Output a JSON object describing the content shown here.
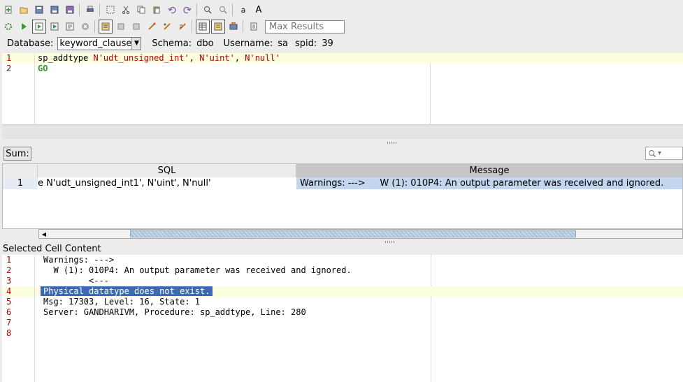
{
  "toolbar": {
    "row1_icons": [
      "new-file-icon",
      "open-file-icon",
      "save-icon",
      "save-as-icon",
      "save-all-icon",
      "print-icon",
      "select-icon",
      "cut-icon",
      "copy-icon",
      "paste-icon",
      "undo-icon",
      "redo-icon",
      "find-icon",
      "find-replace-icon",
      "font-smaller-icon",
      "font-larger-icon"
    ],
    "row2_icons": [
      "run-config-icon",
      "execute-icon",
      "execute-current-icon",
      "execute-all-icon",
      "execute-script-icon",
      "stop-icon",
      "auto-commit-icon",
      "commit-icon",
      "rollback-icon",
      "format-icon",
      "explain-icon",
      "query-builder-icon",
      "results-grid-icon",
      "results-text-icon",
      "export-icon",
      "history-icon"
    ],
    "font_smaller_label": "a",
    "font_larger_label": "A",
    "max_results_placeholder": "Max Results"
  },
  "dbbar": {
    "database_label": "Database:",
    "database_value": "keyword_clause",
    "schema_label": "Schema:",
    "schema_value": "dbo",
    "username_label": "Username:",
    "username_value": "sa",
    "spid_label": "spid:",
    "spid_value": "39"
  },
  "editor": {
    "line_numbers": [
      "1",
      "2"
    ],
    "line1": {
      "fn": "sp_addtype ",
      "p1": "N'udt_unsigned_int'",
      "c1": ", ",
      "p2": "N'uint'",
      "c2": ", ",
      "p3": "N'null'"
    },
    "line2": "GO"
  },
  "results": {
    "sum_label": "Sum:",
    "columns": [
      "SQL",
      "Message"
    ],
    "row": {
      "index": "1",
      "sql": "e N'udt_unsigned_int1', N'uint', N'null'",
      "message": "Warnings: --->     W (1): 010P4: An output parameter was received and ignored."
    }
  },
  "selected_cell": {
    "label": "Selected Cell Content",
    "line_numbers": [
      "1",
      "2",
      "3",
      "4",
      "5",
      "6",
      "7",
      "8"
    ],
    "lines": [
      "Warnings: --->",
      "  W (1): 010P4: An output parameter was received and ignored.",
      "         <---",
      "Physical datatype does not exist.",
      "Msg: 17303, Level: 16, State: 1",
      "Server: GANDHARIVM, Procedure: sp_addtype, Line: 280",
      "",
      ""
    ],
    "highlight_line": 4
  }
}
